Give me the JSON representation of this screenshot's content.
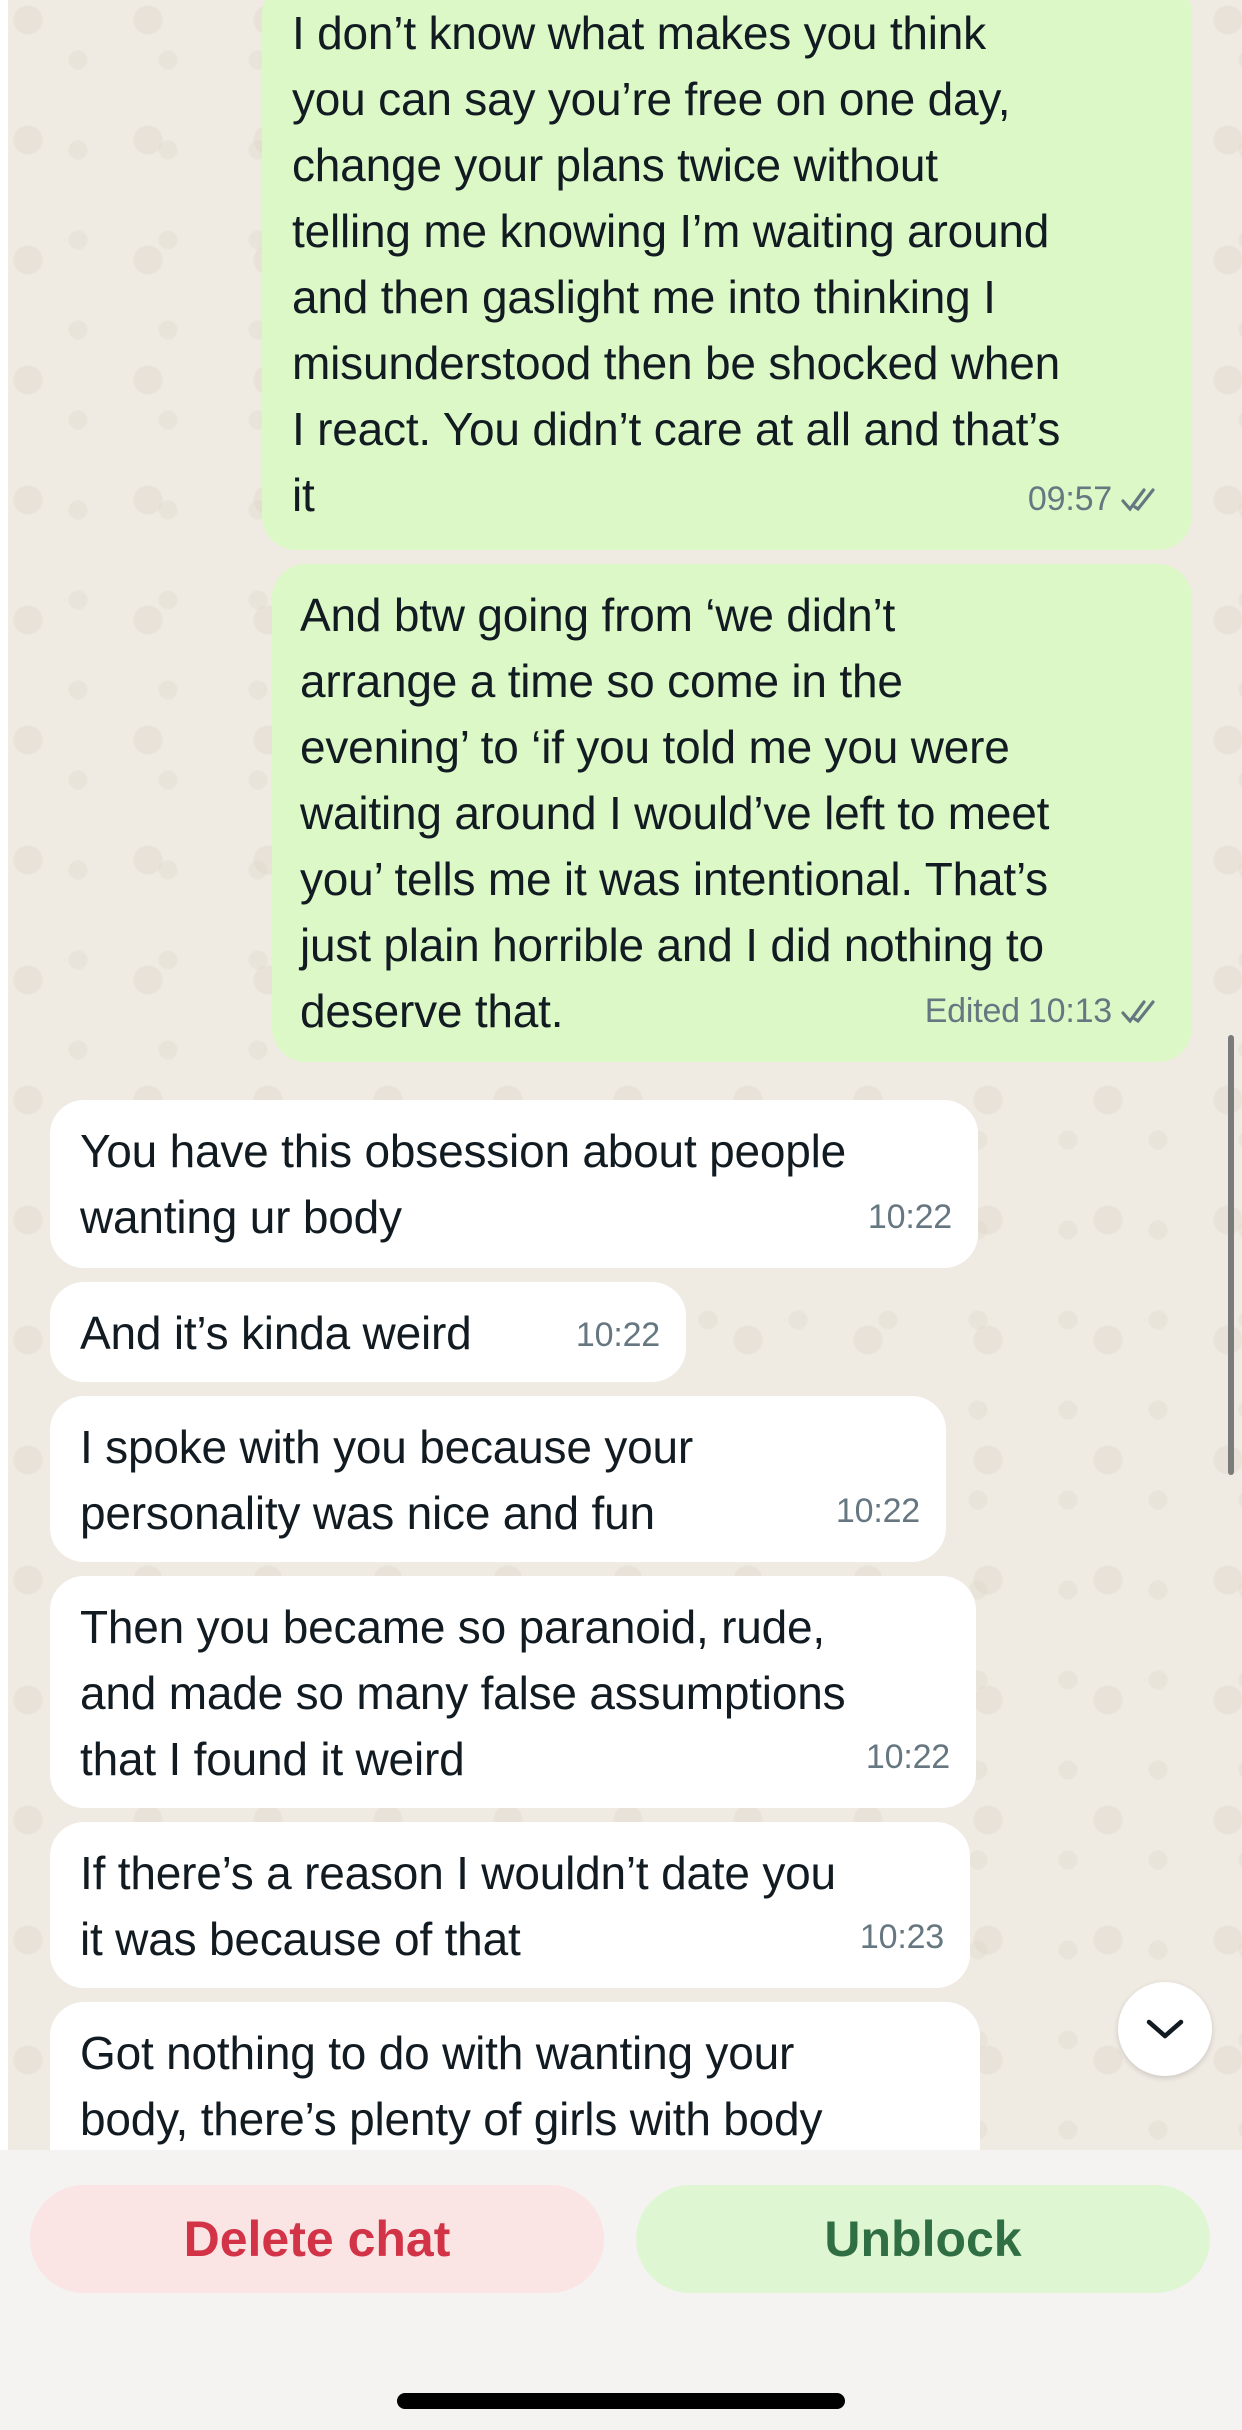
{
  "messages": [
    {
      "direction": "outgoing",
      "text": "I don’t know what makes you think\nyou can say you’re free on one day,\nchange your plans twice without\ntelling me knowing I’m waiting around\nand then gaslight me into thinking I\nmisunderstood then be shocked when\nI react. You didn’t care at all and that’s\nit",
      "time": "09:57",
      "edited": "",
      "status": "read"
    },
    {
      "direction": "outgoing",
      "text": "And btw going from ‘we didn’t\narrange a time so come in the\nevening’ to ‘if you told me you were\nwaiting around I would’ve left to meet\nyou’ tells me it was intentional. That’s\njust plain horrible and I did nothing to\ndeserve that.",
      "time": "10:13",
      "edited": "Edited",
      "status": "read"
    },
    {
      "direction": "incoming",
      "text": "You have this obsession about people\nwanting ur body",
      "time": "10:22"
    },
    {
      "direction": "incoming",
      "text": "And it’s kinda weird",
      "time": "10:22"
    },
    {
      "direction": "incoming",
      "text": "I spoke with you because your\npersonality was nice and fun",
      "time": "10:22"
    },
    {
      "direction": "incoming",
      "text": "Then you became so paranoid, rude,\nand made so many false assumptions\nthat I found it weird",
      "time": "10:22"
    },
    {
      "direction": "incoming",
      "text": "If there’s a reason I wouldn’t date you\nit was because of that",
      "time": "10:23"
    },
    {
      "direction": "incoming",
      "text": "Got nothing to do with wanting your\nbody, there’s plenty of girls with body",
      "time": ""
    }
  ],
  "actions": {
    "delete_label": "Delete chat",
    "unblock_label": "Unblock"
  },
  "icons": {
    "read_receipt": "double-check-icon",
    "scroll_down": "chevron-down-icon"
  },
  "colors": {
    "outgoing_bubble": "#dcf8c6",
    "incoming_bubble": "#ffffff",
    "delete_text": "#d33346",
    "unblock_text": "#2f6f43"
  }
}
